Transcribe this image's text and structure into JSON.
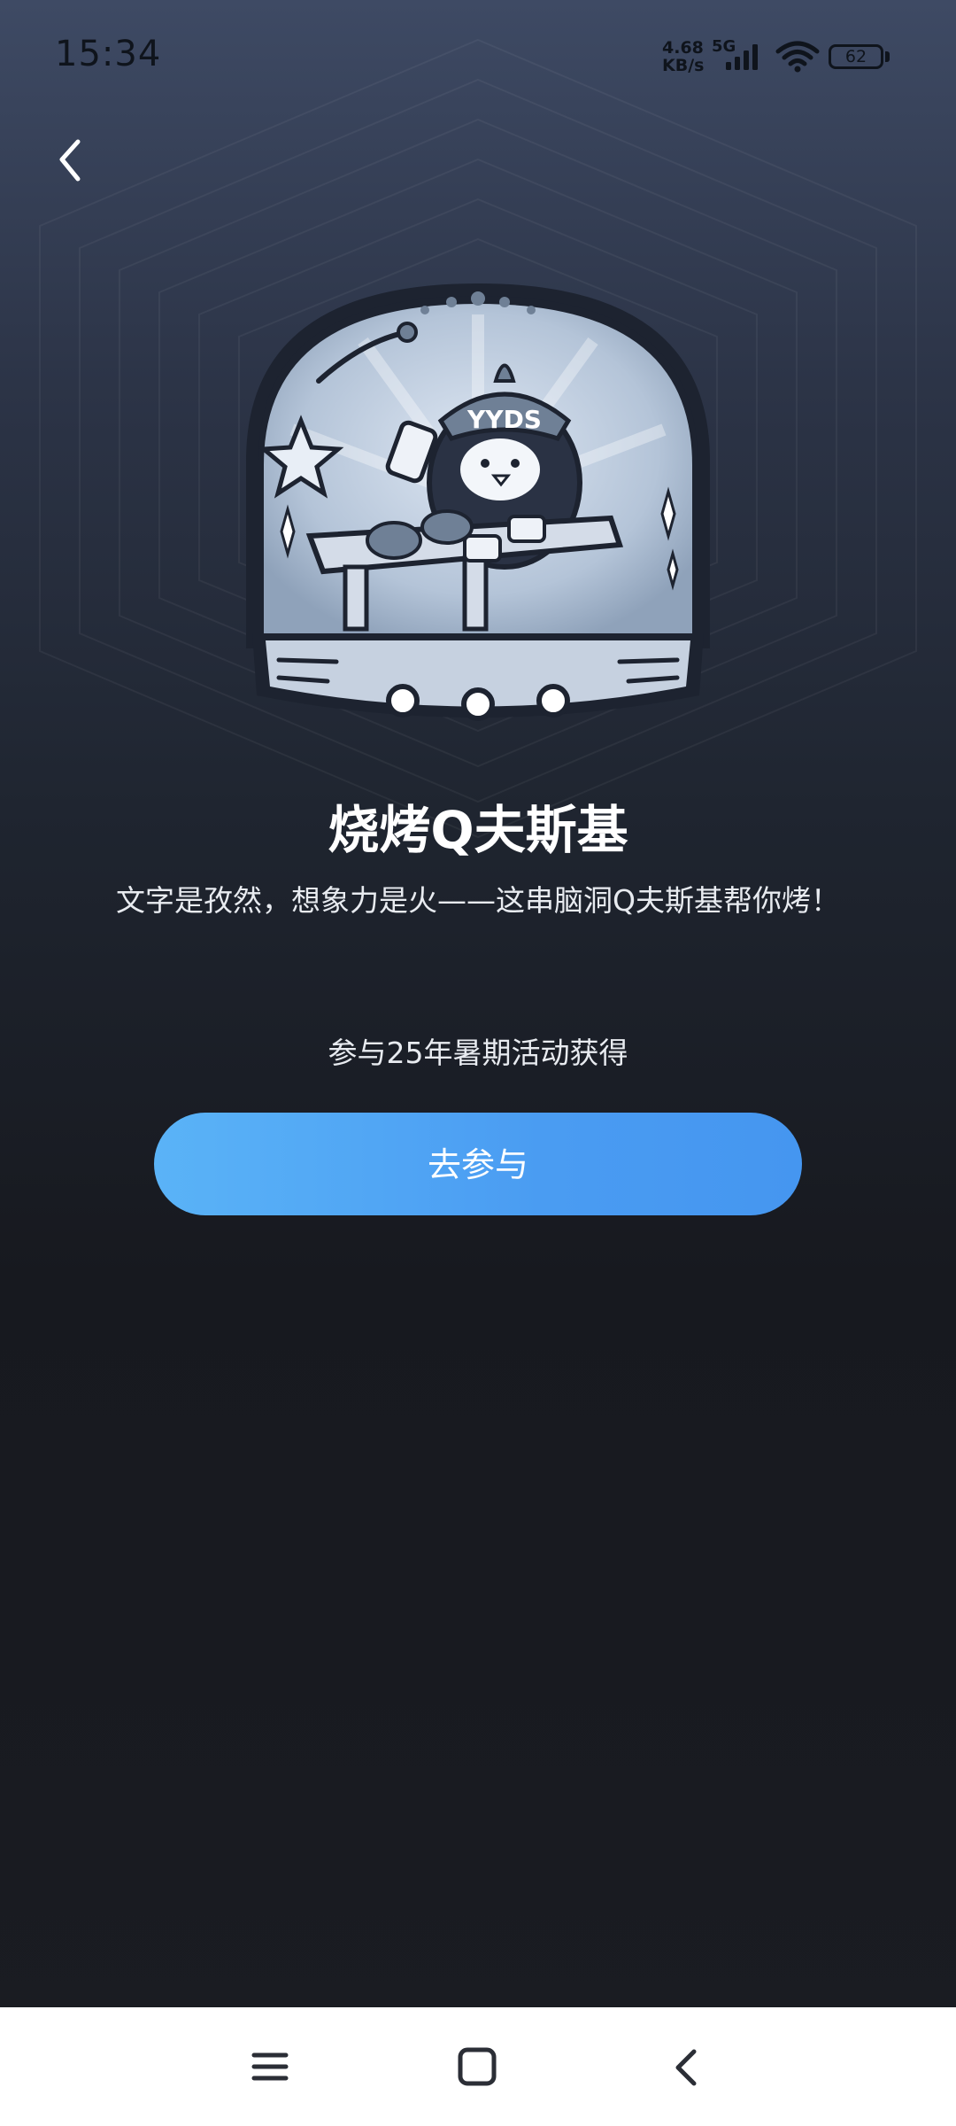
{
  "status_bar": {
    "time": "15:34",
    "net_speed_value": "4.68",
    "net_speed_unit": "KB/s",
    "network_type": "5G",
    "battery": "62",
    "icons": [
      "signal-icon",
      "wifi-icon",
      "battery-icon"
    ]
  },
  "header": {
    "back_icon": "chevron-left-icon"
  },
  "badge": {
    "hat_text": "YYDS",
    "icon": "snow-globe-penguin-bbq-badge"
  },
  "main": {
    "title": "烧烤Q夫斯基",
    "subtitle": "文字是孜然，想象力是火——这串脑洞Q夫斯基帮你烤！",
    "source_text": "参与25年暑期活动获得",
    "join_button_label": "去参与"
  },
  "colors": {
    "accent": "#4a9cf2",
    "accent_light": "#5ab3f7",
    "background_top": "#3e4a64",
    "background_bottom": "#17191f"
  },
  "nav_bar": {
    "icons": [
      "menu-icon",
      "home-icon",
      "back-icon"
    ]
  }
}
